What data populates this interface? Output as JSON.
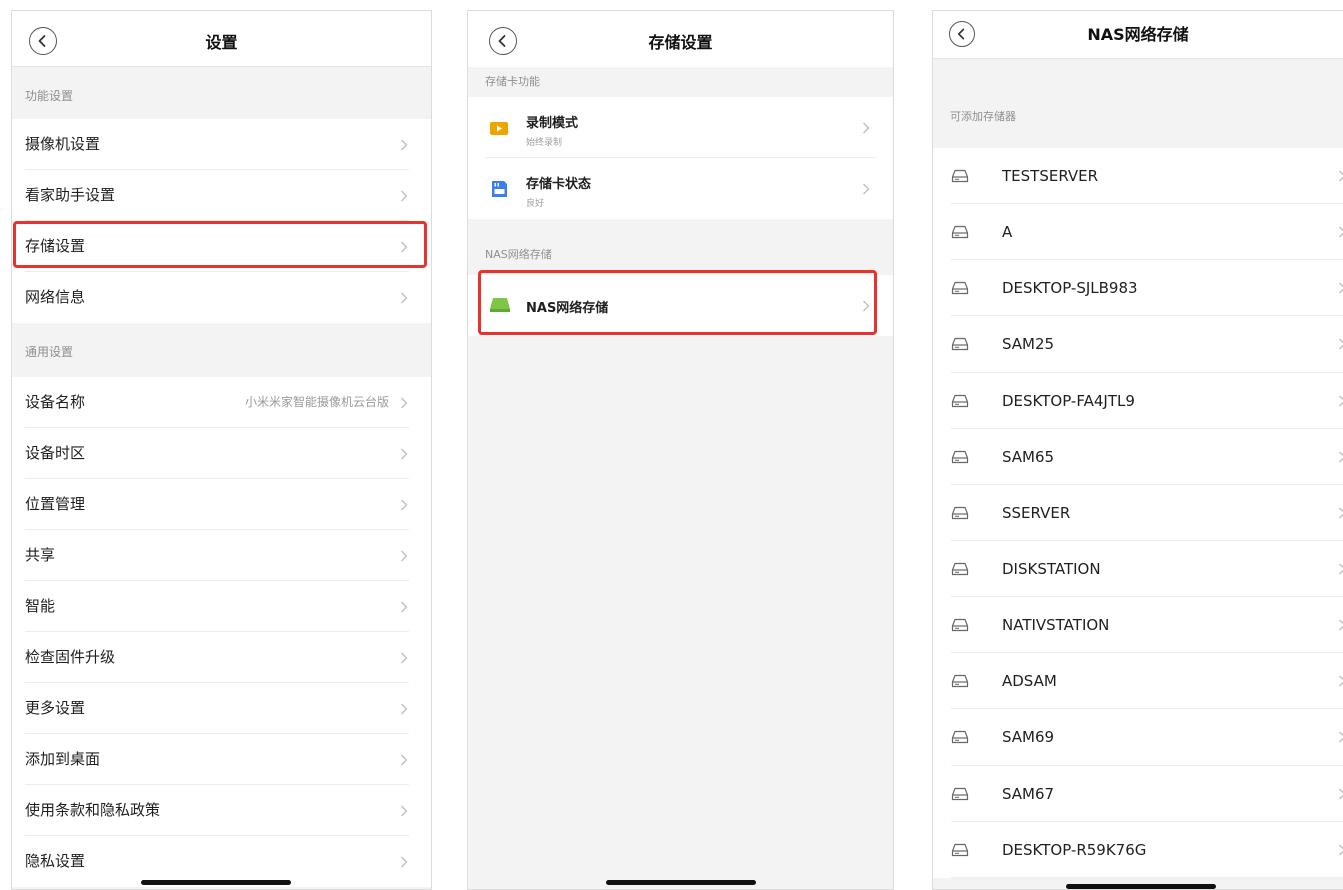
{
  "screen1": {
    "title": "设置",
    "section_function": "功能设置",
    "function_items": [
      {
        "label": "摄像机设置"
      },
      {
        "label": "看家助手设置"
      },
      {
        "label": "存储设置"
      },
      {
        "label": "网络信息"
      }
    ],
    "section_general": "通用设置",
    "general_items": [
      {
        "label": "设备名称",
        "value": "小米米家智能摄像机云台版"
      },
      {
        "label": "设备时区"
      },
      {
        "label": "位置管理"
      },
      {
        "label": "共享"
      },
      {
        "label": "智能"
      },
      {
        "label": "检查固件升级"
      },
      {
        "label": "更多设置"
      },
      {
        "label": "添加到桌面"
      },
      {
        "label": "使用条款和隐私政策"
      },
      {
        "label": "隐私设置"
      }
    ]
  },
  "screen2": {
    "title": "存储设置",
    "section_card": "存储卡功能",
    "card_items": [
      {
        "label": "录制模式",
        "sub": "始终录制",
        "icon": "video-record-icon",
        "color": "#f0a400"
      },
      {
        "label": "存储卡状态",
        "sub": "良好",
        "icon": "sd-card-icon",
        "color": "#3a7ef0"
      }
    ],
    "section_nas": "NAS网络存储",
    "nas_item": {
      "label": "NAS网络存储",
      "icon": "nas-drive-icon",
      "color": "#7fc648"
    }
  },
  "screen3": {
    "title": "NAS网络存储",
    "section": "可添加存储器",
    "devices": [
      "TESTSERVER",
      "A",
      "DESKTOP-SJLB983",
      "SAM25",
      "DESKTOP-FA4JTL9",
      "SAM65",
      "SSERVER",
      "DISKSTATION",
      "NATIVSTATION",
      "ADSAM",
      "SAM69",
      "SAM67",
      "DESKTOP-R59K76G"
    ]
  },
  "colors": {
    "highlight": "#e8322d",
    "background": "#f3f3f3",
    "row": "#ffffff"
  }
}
